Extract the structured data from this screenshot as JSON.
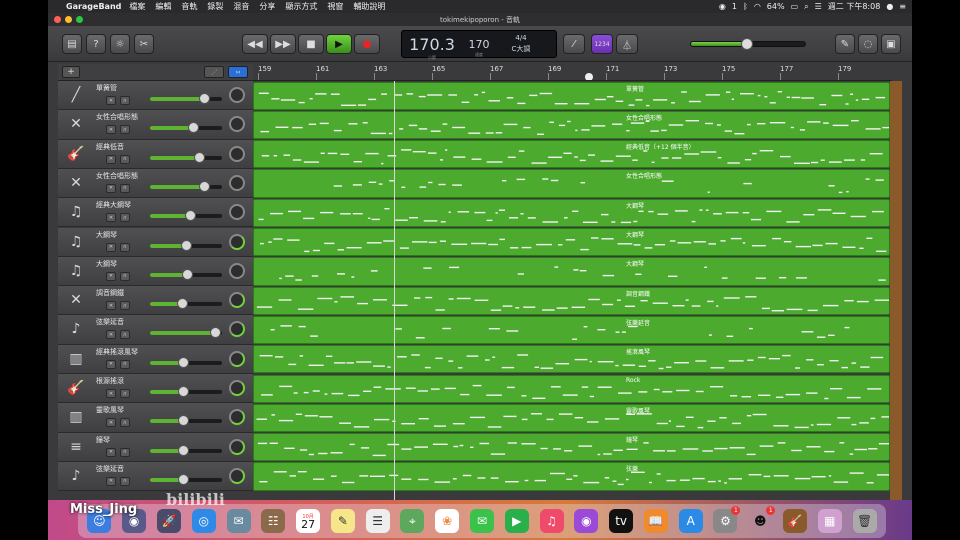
{
  "menubar": {
    "app": "GarageBand",
    "items": [
      "檔案",
      "編輯",
      "音軌",
      "錄製",
      "混音",
      "分享",
      "顯示方式",
      "視窗",
      "輔助說明"
    ],
    "status": {
      "notif": "1",
      "battery": "64%",
      "clock": "週二 下午8:08"
    }
  },
  "window": {
    "title": "tokimekipoporon - 音軌"
  },
  "lcd": {
    "position": "170.3",
    "position_unit": "小節",
    "tempo": "170",
    "tempo_unit": "速度",
    "time_sig": "4/4",
    "key": "C大調"
  },
  "count_in": "1234",
  "master_volume": 0.48,
  "ruler": {
    "bars": [
      "159",
      "161",
      "163",
      "165",
      "167",
      "169",
      "171",
      "173",
      "175",
      "177",
      "179"
    ]
  },
  "tracks": [
    {
      "name": "單簧管",
      "icon": "clarinet-icon",
      "glyph": "╱",
      "volume": 0.75,
      "region": "單簧管",
      "pan_green": false
    },
    {
      "name": "女性合唱形態",
      "icon": "mic-stand-icon",
      "glyph": "✕",
      "volume": 0.6,
      "region": "女性合唱形態",
      "pan_green": false
    },
    {
      "name": "經典低音",
      "icon": "bass-guitar-icon",
      "glyph": "🎸",
      "volume": 0.68,
      "region": "經典低音（+12 個半音）",
      "pan_green": false
    },
    {
      "name": "女性合唱形態",
      "icon": "mic-stand-icon",
      "glyph": "✕",
      "volume": 0.75,
      "region": "女性合唱形態",
      "pan_green": false
    },
    {
      "name": "經典大鋼琴",
      "icon": "grand-piano-icon",
      "glyph": "♫",
      "volume": 0.55,
      "region": "大鋼琴",
      "pan_green": false
    },
    {
      "name": "大鋼琴",
      "icon": "grand-piano-icon",
      "glyph": "♫",
      "volume": 0.5,
      "region": "大鋼琴",
      "pan_green": true
    },
    {
      "name": "大鋼琴",
      "icon": "grand-piano-icon",
      "glyph": "♫",
      "volume": 0.52,
      "region": "大鋼琴",
      "pan_green": false
    },
    {
      "name": "調音鋼鐵",
      "icon": "mic-stand-icon",
      "glyph": "✕",
      "volume": 0.44,
      "region": "調音鋼鐵",
      "pan_green": true
    },
    {
      "name": "弦樂延音",
      "icon": "strings-icon",
      "glyph": "♪",
      "volume": 0.9,
      "region": "弦樂延音",
      "pan_green": true
    },
    {
      "name": "經典搖滾風琴",
      "icon": "organ-icon",
      "glyph": "▥",
      "volume": 0.46,
      "region": "搖滾風琴",
      "pan_green": true
    },
    {
      "name": "根源搖滾",
      "icon": "guitar-icon",
      "glyph": "🎸",
      "volume": 0.46,
      "region": "Rock",
      "pan_green": true
    },
    {
      "name": "靈歌風琴",
      "icon": "organ-icon",
      "glyph": "▥",
      "volume": 0.46,
      "region": "靈歌風琴",
      "pan_green": true
    },
    {
      "name": "鐘琴",
      "icon": "glockenspiel-icon",
      "glyph": "≡",
      "volume": 0.46,
      "region": "鐘琴",
      "pan_green": true
    },
    {
      "name": "弦樂延音",
      "icon": "strings-icon",
      "glyph": "♪",
      "volume": 0.46,
      "region": "弦樂",
      "pan_green": true
    }
  ],
  "watermark": "Miss_Jing",
  "watermark2": "bilibili",
  "dock": {
    "calendar_day": "27",
    "calendar_month": "10月",
    "badges": {
      "settings": "1",
      "qq": "1"
    }
  }
}
